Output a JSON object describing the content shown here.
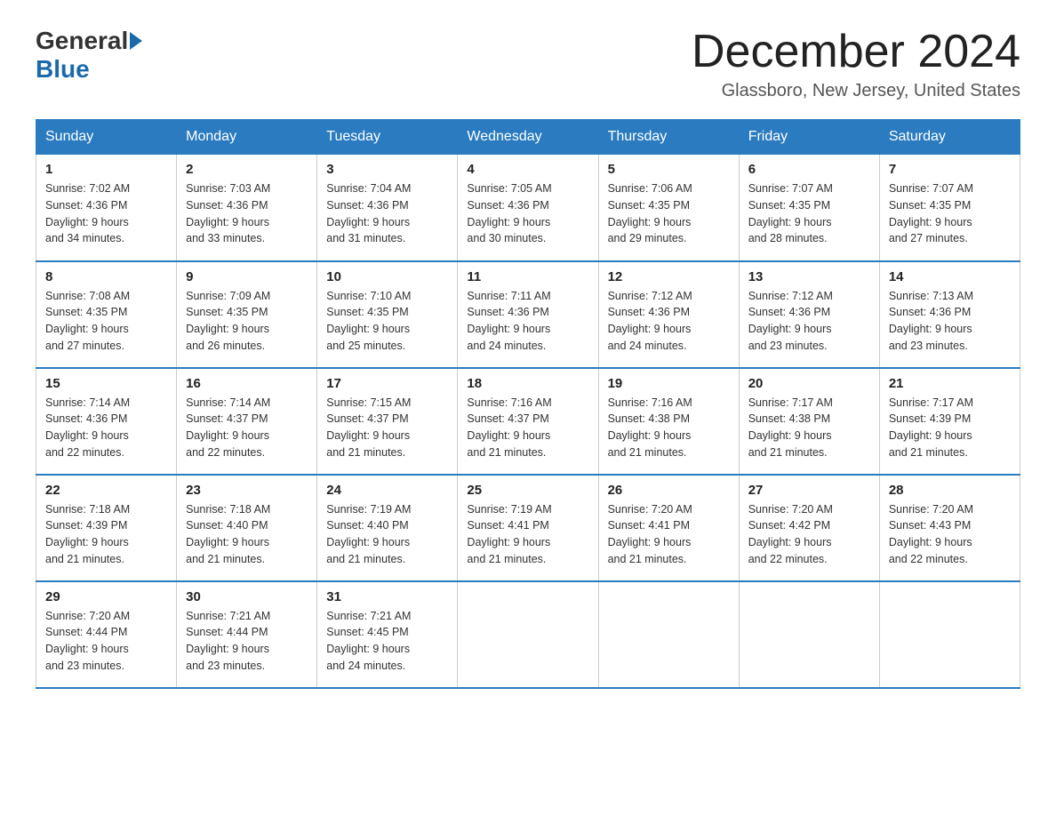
{
  "header": {
    "logo_general": "General",
    "logo_blue": "Blue",
    "month_title": "December 2024",
    "location": "Glassboro, New Jersey, United States"
  },
  "days_of_week": [
    "Sunday",
    "Monday",
    "Tuesday",
    "Wednesday",
    "Thursday",
    "Friday",
    "Saturday"
  ],
  "weeks": [
    [
      {
        "day": "1",
        "sunrise": "7:02 AM",
        "sunset": "4:36 PM",
        "daylight": "9 hours and 34 minutes."
      },
      {
        "day": "2",
        "sunrise": "7:03 AM",
        "sunset": "4:36 PM",
        "daylight": "9 hours and 33 minutes."
      },
      {
        "day": "3",
        "sunrise": "7:04 AM",
        "sunset": "4:36 PM",
        "daylight": "9 hours and 31 minutes."
      },
      {
        "day": "4",
        "sunrise": "7:05 AM",
        "sunset": "4:36 PM",
        "daylight": "9 hours and 30 minutes."
      },
      {
        "day": "5",
        "sunrise": "7:06 AM",
        "sunset": "4:35 PM",
        "daylight": "9 hours and 29 minutes."
      },
      {
        "day": "6",
        "sunrise": "7:07 AM",
        "sunset": "4:35 PM",
        "daylight": "9 hours and 28 minutes."
      },
      {
        "day": "7",
        "sunrise": "7:07 AM",
        "sunset": "4:35 PM",
        "daylight": "9 hours and 27 minutes."
      }
    ],
    [
      {
        "day": "8",
        "sunrise": "7:08 AM",
        "sunset": "4:35 PM",
        "daylight": "9 hours and 27 minutes."
      },
      {
        "day": "9",
        "sunrise": "7:09 AM",
        "sunset": "4:35 PM",
        "daylight": "9 hours and 26 minutes."
      },
      {
        "day": "10",
        "sunrise": "7:10 AM",
        "sunset": "4:35 PM",
        "daylight": "9 hours and 25 minutes."
      },
      {
        "day": "11",
        "sunrise": "7:11 AM",
        "sunset": "4:36 PM",
        "daylight": "9 hours and 24 minutes."
      },
      {
        "day": "12",
        "sunrise": "7:12 AM",
        "sunset": "4:36 PM",
        "daylight": "9 hours and 24 minutes."
      },
      {
        "day": "13",
        "sunrise": "7:12 AM",
        "sunset": "4:36 PM",
        "daylight": "9 hours and 23 minutes."
      },
      {
        "day": "14",
        "sunrise": "7:13 AM",
        "sunset": "4:36 PM",
        "daylight": "9 hours and 23 minutes."
      }
    ],
    [
      {
        "day": "15",
        "sunrise": "7:14 AM",
        "sunset": "4:36 PM",
        "daylight": "9 hours and 22 minutes."
      },
      {
        "day": "16",
        "sunrise": "7:14 AM",
        "sunset": "4:37 PM",
        "daylight": "9 hours and 22 minutes."
      },
      {
        "day": "17",
        "sunrise": "7:15 AM",
        "sunset": "4:37 PM",
        "daylight": "9 hours and 21 minutes."
      },
      {
        "day": "18",
        "sunrise": "7:16 AM",
        "sunset": "4:37 PM",
        "daylight": "9 hours and 21 minutes."
      },
      {
        "day": "19",
        "sunrise": "7:16 AM",
        "sunset": "4:38 PM",
        "daylight": "9 hours and 21 minutes."
      },
      {
        "day": "20",
        "sunrise": "7:17 AM",
        "sunset": "4:38 PM",
        "daylight": "9 hours and 21 minutes."
      },
      {
        "day": "21",
        "sunrise": "7:17 AM",
        "sunset": "4:39 PM",
        "daylight": "9 hours and 21 minutes."
      }
    ],
    [
      {
        "day": "22",
        "sunrise": "7:18 AM",
        "sunset": "4:39 PM",
        "daylight": "9 hours and 21 minutes."
      },
      {
        "day": "23",
        "sunrise": "7:18 AM",
        "sunset": "4:40 PM",
        "daylight": "9 hours and 21 minutes."
      },
      {
        "day": "24",
        "sunrise": "7:19 AM",
        "sunset": "4:40 PM",
        "daylight": "9 hours and 21 minutes."
      },
      {
        "day": "25",
        "sunrise": "7:19 AM",
        "sunset": "4:41 PM",
        "daylight": "9 hours and 21 minutes."
      },
      {
        "day": "26",
        "sunrise": "7:20 AM",
        "sunset": "4:41 PM",
        "daylight": "9 hours and 21 minutes."
      },
      {
        "day": "27",
        "sunrise": "7:20 AM",
        "sunset": "4:42 PM",
        "daylight": "9 hours and 22 minutes."
      },
      {
        "day": "28",
        "sunrise": "7:20 AM",
        "sunset": "4:43 PM",
        "daylight": "9 hours and 22 minutes."
      }
    ],
    [
      {
        "day": "29",
        "sunrise": "7:20 AM",
        "sunset": "4:44 PM",
        "daylight": "9 hours and 23 minutes."
      },
      {
        "day": "30",
        "sunrise": "7:21 AM",
        "sunset": "4:44 PM",
        "daylight": "9 hours and 23 minutes."
      },
      {
        "day": "31",
        "sunrise": "7:21 AM",
        "sunset": "4:45 PM",
        "daylight": "9 hours and 24 minutes."
      },
      null,
      null,
      null,
      null
    ]
  ],
  "labels": {
    "sunrise": "Sunrise:",
    "sunset": "Sunset:",
    "daylight": "Daylight:"
  }
}
